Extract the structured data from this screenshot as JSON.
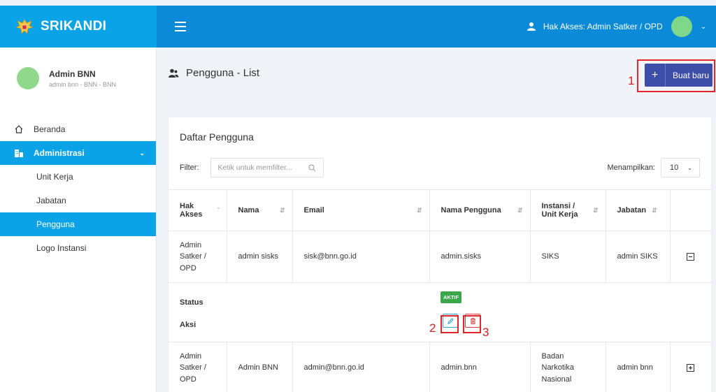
{
  "app": {
    "name": "SRIKANDI"
  },
  "topbar": {
    "access_text": "Hak Akses: Admin Satker / OPD"
  },
  "profile": {
    "name": "Admin BNN",
    "subtitle": "admin bnn - BNN - BNN"
  },
  "sidebar": {
    "items": [
      {
        "label": "Beranda"
      },
      {
        "label": "Administrasi"
      }
    ],
    "submenu": [
      {
        "label": "Unit Kerja"
      },
      {
        "label": "Jabatan"
      },
      {
        "label": "Pengguna"
      },
      {
        "label": "Logo Instansi"
      }
    ]
  },
  "page": {
    "title": "Pengguna",
    "title_suffix": " - List",
    "new_button": "Buat baru"
  },
  "annotations": {
    "a1": "1",
    "a2": "2",
    "a3": "3"
  },
  "card": {
    "title": "Daftar Pengguna",
    "filter_label": "Filter:",
    "filter_placeholder": "Ketik untuk memfilter...",
    "show_label": "Menampilkan:",
    "show_value": "10"
  },
  "table": {
    "headers": [
      "Hak Akses",
      "Nama",
      "Email",
      "Nama Pengguna",
      "Instansi / Unit Kerja",
      "Jabatan"
    ],
    "rows": [
      {
        "hak_akses": "Admin Satker / OPD",
        "nama": "admin sisks",
        "email": "sisk@bnn.go.id",
        "username": "admin.sisks",
        "instansi": "SIKS",
        "jabatan": "admin SIKS"
      },
      {
        "hak_akses": "Admin Satker / OPD",
        "nama": "Admin BNN",
        "email": "admin@bnn.go.id",
        "username": "admin.bnn",
        "instansi": "Badan Narkotika Nasional",
        "jabatan": "admin bnn"
      }
    ],
    "detail": {
      "status_label": "Status",
      "status_value": "AKTIF",
      "action_label": "Aksi"
    }
  },
  "colors": {
    "brand": "#0aa3e8",
    "topbar": "#0b8bd7",
    "primary_button": "#3c4ea8",
    "status_active": "#3aa84a",
    "annotation": "#d21f1f"
  }
}
